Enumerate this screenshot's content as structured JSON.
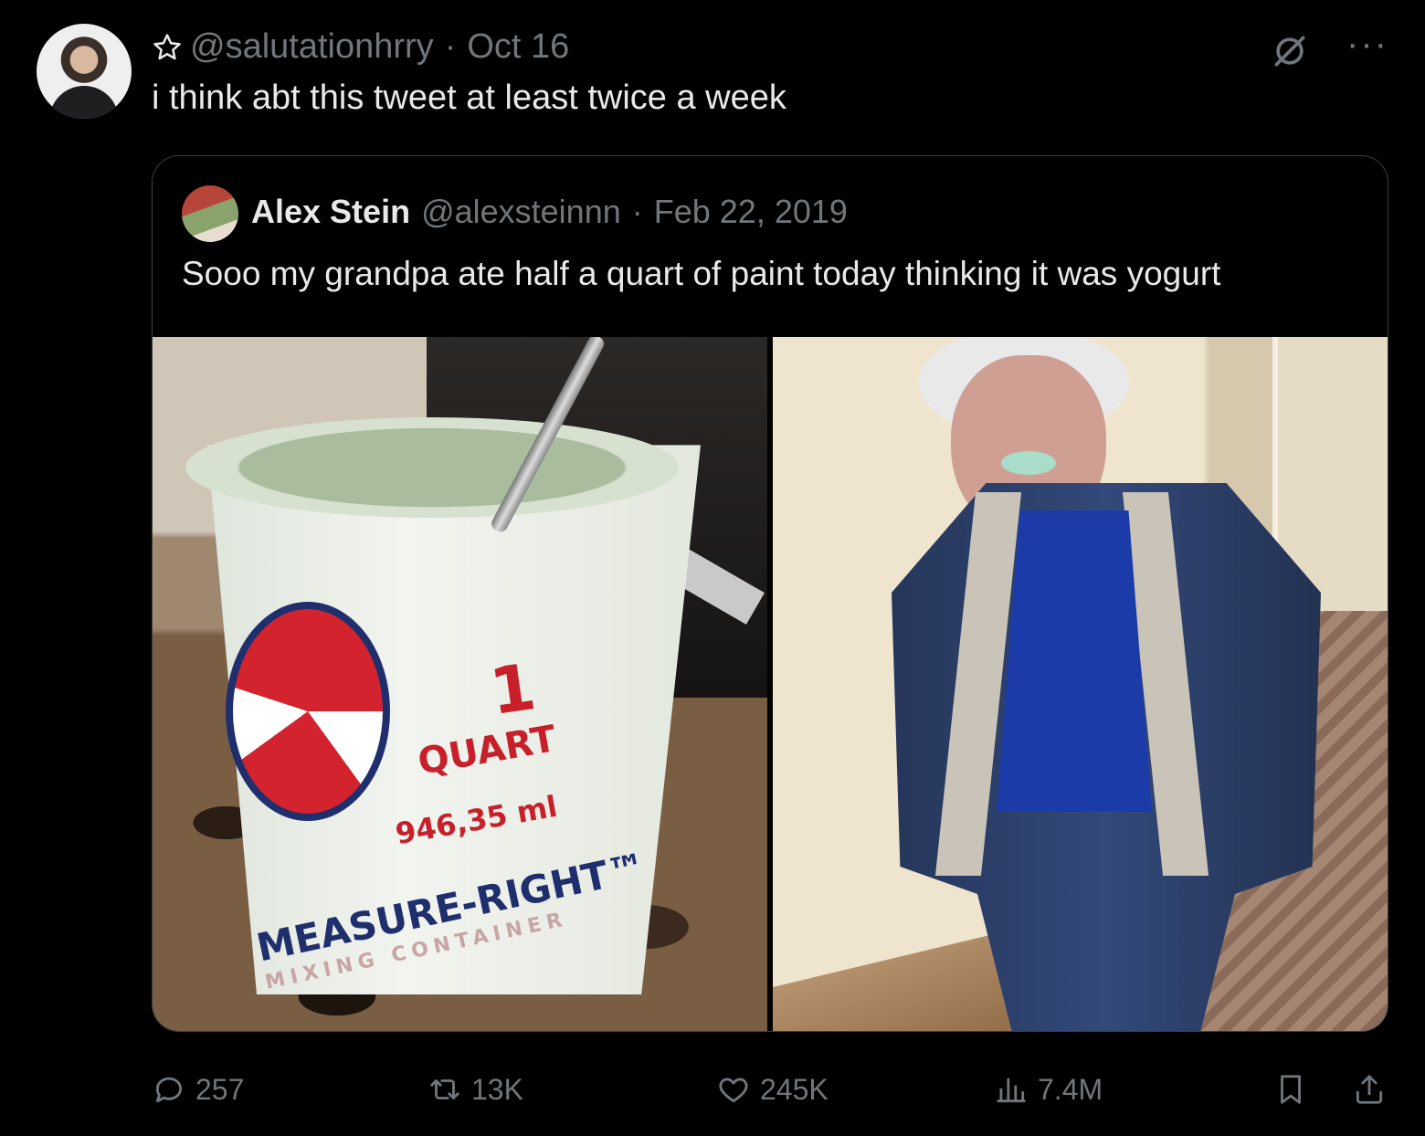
{
  "tweet": {
    "handle": "@salutationhrry",
    "separator": "·",
    "date": "Oct 16",
    "text": "i think abt this tweet at least twice a week"
  },
  "quoted": {
    "name": "Alex Stein",
    "handle": "@alexsteinnn",
    "separator": "·",
    "date": "Feb 22, 2019",
    "text": "Sooo my grandpa ate half a quart of paint today thinking it was yogurt",
    "photo_left_labels": {
      "big_number": "1",
      "unit": "QUART",
      "metric": "946,35 ml",
      "brand": "MEASURE-RIGHT™",
      "sub": "MIXING CONTAINER"
    }
  },
  "actions": {
    "replies": "257",
    "retweets": "13K",
    "likes": "245K",
    "views": "7.4M"
  },
  "icons": {
    "top_right": [
      "no-edit-icon",
      "more-icon"
    ],
    "bar": [
      "reply-icon",
      "retweet-icon",
      "like-icon",
      "views-icon",
      "bookmark-icon",
      "share-icon"
    ]
  },
  "colors": {
    "background": "#000000",
    "text": "#e7e9ea",
    "secondary": "#71767b",
    "border": "#3a3e42"
  }
}
